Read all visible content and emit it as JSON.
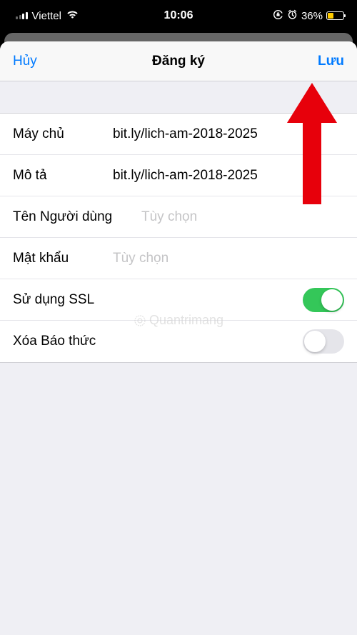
{
  "status": {
    "carrier": "Viettel",
    "time": "10:06",
    "battery_percent": "36%"
  },
  "nav": {
    "cancel": "Hủy",
    "title": "Đăng ký",
    "save": "Lưu"
  },
  "form": {
    "server": {
      "label": "Máy chủ",
      "value": "bit.ly/lich-am-2018-2025"
    },
    "description": {
      "label": "Mô tả",
      "value": "bit.ly/lich-am-2018-2025"
    },
    "username": {
      "label": "Tên Người dùng",
      "placeholder": "Tùy chọn"
    },
    "password": {
      "label": "Mật khẩu",
      "placeholder": "Tùy chọn"
    },
    "use_ssl": {
      "label": "Sử dụng SSL",
      "on": true
    },
    "remove_alarms": {
      "label": "Xóa Báo thức",
      "on": false
    }
  },
  "watermark": "Quantrimang",
  "colors": {
    "accent": "#007aff",
    "toggle_on": "#34c759",
    "arrow": "#e7000b"
  }
}
